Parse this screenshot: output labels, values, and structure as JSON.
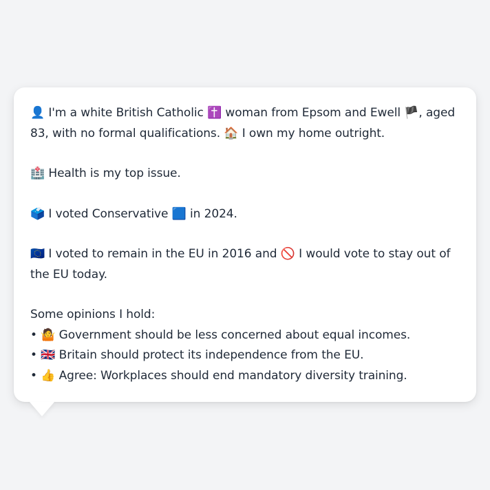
{
  "persona": {
    "intro_icon": "👤",
    "intro_text_a": "I'm a white British Catholic",
    "religion_icon": "✝️",
    "intro_text_b": "woman from Epsom and Ewell",
    "region_icon": "🏴",
    "intro_text_c": ", aged 83, with no formal qualifications.",
    "home_icon": "🏠",
    "home_text": "I own my home outright.",
    "issue_icon": "🏥",
    "issue_text": "Health is my top issue.",
    "vote_icon": "🗳️",
    "vote_text_a": "I voted Conservative",
    "party_icon": "🟦",
    "vote_text_b": "in 2024.",
    "eu_icon": "🇪🇺",
    "eu_text_a": "I voted to remain in the EU in 2016 and",
    "no_icon": "🚫",
    "eu_text_b": "I would vote to stay out of the EU today.",
    "opinions_heading": "Some opinions I hold:",
    "opinions": [
      {
        "bullet": "•",
        "icon": "🤷",
        "text": "Government should be less concerned about equal incomes."
      },
      {
        "bullet": "•",
        "icon": "🇬🇧",
        "text": "Britain should protect its independence from the EU."
      },
      {
        "bullet": "•",
        "icon": "👍",
        "text": "Agree: Workplaces should end mandatory diversity training."
      }
    ]
  }
}
